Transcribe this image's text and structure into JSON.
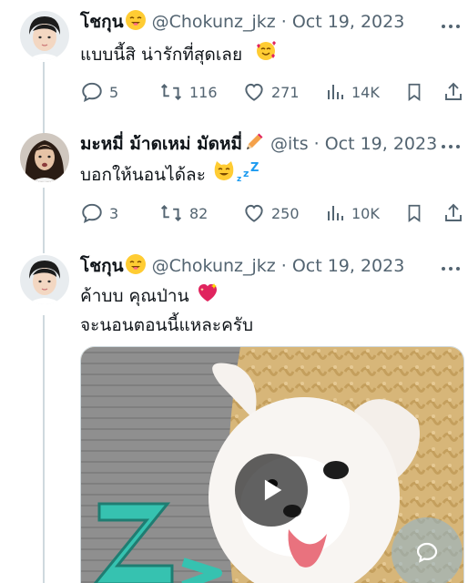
{
  "colors": {
    "text": "#0f1419",
    "muted": "#536471",
    "line": "#cfd9de",
    "accent": "#1d9bf0"
  },
  "tweets": [
    {
      "name": "โชกุน",
      "name_emoji": "smiling-face-icon",
      "handle": "@Chokunz_jkz",
      "sep": "·",
      "date": "Oct 19, 2023",
      "text_lines": [
        "แบบนี้สิ น่ารักที่สุดเลย"
      ],
      "text_emoji": "smiling-face-with-hearts-icon",
      "replies": "5",
      "retweets": "116",
      "likes": "271",
      "views": "14K"
    },
    {
      "name": "มะหมี่ ม้าดเหม่ มัดหมี่",
      "name_emoji": "pencil-icon",
      "handle": "@its",
      "sep": "·",
      "date": "Oct 19, 2023",
      "text_lines": [
        "บอกให้นอนได้ละ"
      ],
      "text_emoji": "grinning-cat-zzz-icon",
      "replies": "3",
      "retweets": "82",
      "likes": "250",
      "views": "10K"
    },
    {
      "name": "โชกุน",
      "name_emoji": "smiling-face-icon",
      "handle": "@Chokunz_jkz",
      "sep": "·",
      "date": "Oct 19, 2023",
      "text_lines": [
        "ค้าบบ คุณป่าน",
        "จะนอนตอนนี้แหละครับ"
      ],
      "text_emoji": "sparkling-heart-icon"
    }
  ],
  "media": {
    "type": "video",
    "overlay_glyph": "Z"
  }
}
